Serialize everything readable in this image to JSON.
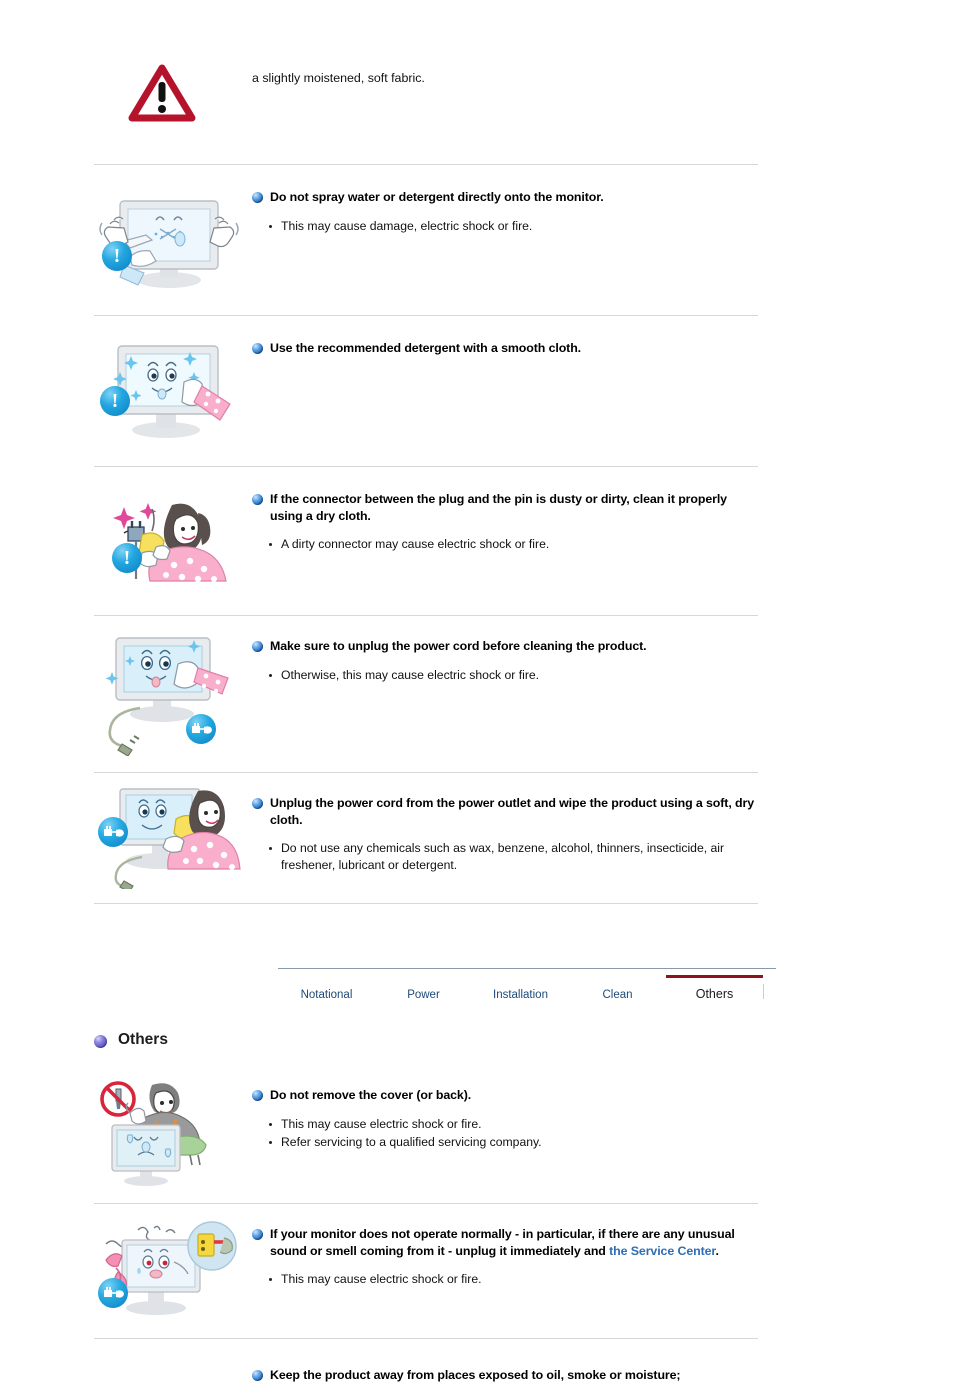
{
  "page": {
    "intro_text": "a slightly moistened, soft fabric.",
    "warning_icon": "warning-triangle-icon"
  },
  "clean_section": {
    "items": [
      {
        "heading": "Do not spray water or detergent directly onto the monitor.",
        "bullets": [
          "This may cause damage, electric shock or fire."
        ],
        "figure": "monitor-spray-illustration"
      },
      {
        "heading": "Use the recommended detergent with a smooth cloth.",
        "bullets": [],
        "figure": "monitor-wipe-cloth-illustration"
      },
      {
        "heading": "If the connector between the plug and the pin is dusty or dirty, clean it properly using a dry cloth.",
        "bullets": [
          "A dirty connector may cause electric shock or fire."
        ],
        "figure": "woman-cleaning-plug-illustration"
      },
      {
        "heading": "Make sure to unplug the power cord before cleaning the product.",
        "bullets": [
          "Otherwise, this may cause electric shock or fire."
        ],
        "figure": "monitor-unplug-wipe-illustration"
      },
      {
        "heading": "Unplug the power cord from the power outlet and wipe the product using a soft, dry cloth.",
        "bullets": [
          "Do not use any chemicals such as wax, benzene, alcohol, thinners, insecticide, air freshener, lubricant or detergent."
        ],
        "figure": "woman-wiping-monitor-illustration"
      }
    ]
  },
  "tabs": {
    "items": [
      {
        "label": "Notational",
        "active": false
      },
      {
        "label": "Power",
        "active": false
      },
      {
        "label": "Installation",
        "active": false
      },
      {
        "label": "Clean",
        "active": false
      },
      {
        "label": "Others",
        "active": true
      }
    ],
    "active_underline_color": "#8b1322",
    "link_color": "#1e4a78"
  },
  "others_section": {
    "title": "Others",
    "items": [
      {
        "heading": "Do not remove the cover (or back).",
        "bullets": [
          "This may cause electric shock or fire.",
          "Refer servicing to a qualified servicing company."
        ],
        "figure": "no-screwdriver-technician-illustration"
      },
      {
        "heading_part1": "If your monitor does not operate normally - in particular, if there are any unusual sound or smell coming from it - unplug it immediately and ",
        "heading_link": "the Service Center",
        "heading_part2": ".",
        "bullets": [
          "This may cause electric shock or fire."
        ],
        "figure": "monitor-smoke-phone-illustration"
      },
      {
        "heading": "Keep the product away from places exposed to oil, smoke or moisture;",
        "bullets": [],
        "figure": ""
      }
    ]
  },
  "colors": {
    "warning_red": "#b5122c",
    "link_blue": "#2f6db5",
    "tab_blue": "#1e4a78",
    "active_tab_underline": "#8b1322",
    "rule_gray": "#d5d7da"
  }
}
